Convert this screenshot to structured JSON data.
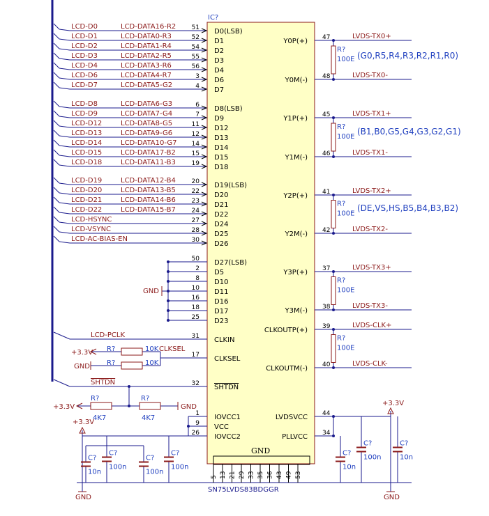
{
  "ic": {
    "ref": "IC?",
    "part": "SN75LVDS83BDGGR",
    "gnd_label": "GND",
    "left_pins": [
      {
        "num": "51",
        "name": "D0(LSB)",
        "net": "LCD-D0",
        "alias": "LCD-DATA16-R2"
      },
      {
        "num": "52",
        "name": "D1",
        "net": "LCD-D1",
        "alias": "LCD-DATA0-R3"
      },
      {
        "num": "54",
        "name": "D2",
        "net": "LCD-D2",
        "alias": "LCD-DATA1-R4"
      },
      {
        "num": "55",
        "name": "D3",
        "net": "LCD-D3",
        "alias": "LCD-DATA2-R5"
      },
      {
        "num": "56",
        "name": "D4",
        "net": "LCD-D4",
        "alias": "LCD-DATA3-R6"
      },
      {
        "num": "3",
        "name": "D6",
        "net": "LCD-D6",
        "alias": "LCD-DATA4-R7"
      },
      {
        "num": "4",
        "name": "D7",
        "net": "LCD-D7",
        "alias": "LCD-DATA5-G2"
      },
      {
        "num": "6",
        "name": "D8(LSB)",
        "net": "LCD-D8",
        "alias": "LCD-DATA6-G3"
      },
      {
        "num": "7",
        "name": "D9",
        "net": "LCD-D9",
        "alias": "LCD-DATA7-G4"
      },
      {
        "num": "11",
        "name": "D12",
        "net": "LCD-D12",
        "alias": "LCD-DATA8-G5"
      },
      {
        "num": "12",
        "name": "D13",
        "net": "LCD-D13",
        "alias": "LCD-DATA9-G6"
      },
      {
        "num": "14",
        "name": "D14",
        "net": "LCD-D14",
        "alias": "LCD-DATA10-G7"
      },
      {
        "num": "15",
        "name": "D15",
        "net": "LCD-D15",
        "alias": "LCD-DATA17-B2"
      },
      {
        "num": "19",
        "name": "D18",
        "net": "LCD-D18",
        "alias": "LCD-DATA11-B3"
      },
      {
        "num": "20",
        "name": "D19(LSB)",
        "net": "LCD-D19",
        "alias": "LCD-DATA12-B4"
      },
      {
        "num": "22",
        "name": "D20",
        "net": "LCD-D20",
        "alias": "LCD-DATA13-B5"
      },
      {
        "num": "23",
        "name": "D21",
        "net": "LCD-D21",
        "alias": "LCD-DATA14-B6"
      },
      {
        "num": "24",
        "name": "D22",
        "net": "LCD-D22",
        "alias": "LCD-DATA15-B7"
      },
      {
        "num": "27",
        "name": "D24",
        "net": "LCD-HSYNC",
        "alias": ""
      },
      {
        "num": "28",
        "name": "D25",
        "net": "LCD-VSYNC",
        "alias": ""
      },
      {
        "num": "30",
        "name": "D26",
        "net": "LCD-AC-BIAS-EN",
        "alias": ""
      },
      {
        "num": "50",
        "name": "D27(LSB)",
        "net": "",
        "alias": ""
      },
      {
        "num": "2",
        "name": "D5",
        "net": "",
        "alias": ""
      },
      {
        "num": "8",
        "name": "D10",
        "net": "",
        "alias": ""
      },
      {
        "num": "10",
        "name": "D11",
        "net": "",
        "alias": ""
      },
      {
        "num": "16",
        "name": "D16",
        "net": "",
        "alias": ""
      },
      {
        "num": "18",
        "name": "D17",
        "net": "",
        "alias": ""
      },
      {
        "num": "25",
        "name": "D23",
        "net": "",
        "alias": ""
      },
      {
        "num": "31",
        "name": "CLKIN",
        "net": "LCD-PCLK",
        "alias": ""
      },
      {
        "num": "17",
        "name": "CLKSEL",
        "net": "CLKSEL",
        "alias": ""
      },
      {
        "num": "32",
        "name": "SHTDN",
        "net": "SHTDN",
        "alias": ""
      },
      {
        "num": "1",
        "name": "IOVCC1",
        "net": "",
        "alias": ""
      },
      {
        "num": "9",
        "name": "VCC",
        "net": "",
        "alias": ""
      },
      {
        "num": "26",
        "name": "IOVCC2",
        "net": "",
        "alias": ""
      }
    ],
    "right_pins": [
      {
        "num": "47",
        "name": "Y0P(+)",
        "net": "LVDS-TX0+"
      },
      {
        "num": "48",
        "name": "Y0M(-)",
        "net": "LVDS-TX0-"
      },
      {
        "num": "45",
        "name": "Y1P(+)",
        "net": "LVDS-TX1+"
      },
      {
        "num": "46",
        "name": "Y1M(-)",
        "net": "LVDS-TX1-"
      },
      {
        "num": "41",
        "name": "Y2P(+)",
        "net": "LVDS-TX2+"
      },
      {
        "num": "42",
        "name": "Y2M(-)",
        "net": "LVDS-TX2-"
      },
      {
        "num": "37",
        "name": "Y3P(+)",
        "net": "LVDS-TX3+"
      },
      {
        "num": "38",
        "name": "Y3M(-)",
        "net": "LVDS-TX3-"
      },
      {
        "num": "39",
        "name": "CLKOUTP(+)",
        "net": "LVDS-CLK+"
      },
      {
        "num": "40",
        "name": "CLKOUTM(-)",
        "net": "LVDS-CLK-"
      },
      {
        "num": "44",
        "name": "LVDSVCC",
        "net": ""
      },
      {
        "num": "34",
        "name": "PLLVCC",
        "net": ""
      }
    ],
    "bottom_pins": [
      "5",
      "13",
      "21",
      "29",
      "33",
      "35",
      "36",
      "43",
      "49",
      "53"
    ]
  },
  "annotations": {
    "pair0": "(G0,R5,R4,R3,R2,R1,R0)",
    "pair1": "(B1,B0,G5,G4,G3,G2,G1)",
    "pair2": "(DE,VS,HS,B5,B4,B3,B2)"
  },
  "resistors": {
    "term_ref": "R?",
    "term_val": "100E",
    "clksel_hi_ref": "R?",
    "clksel_hi_val": "10K",
    "clksel_lo_ref": "R?",
    "clksel_lo_val": "10K",
    "shtdn_a_ref": "R?",
    "shtdn_a_val": "4K7",
    "shtdn_b_ref": "R?",
    "shtdn_b_val": "4K7"
  },
  "capacitors": {
    "ref": "C?",
    "c10n": "10n",
    "c100n": "100n"
  },
  "power": {
    "v33": "+3.3V",
    "gnd": "GND"
  }
}
